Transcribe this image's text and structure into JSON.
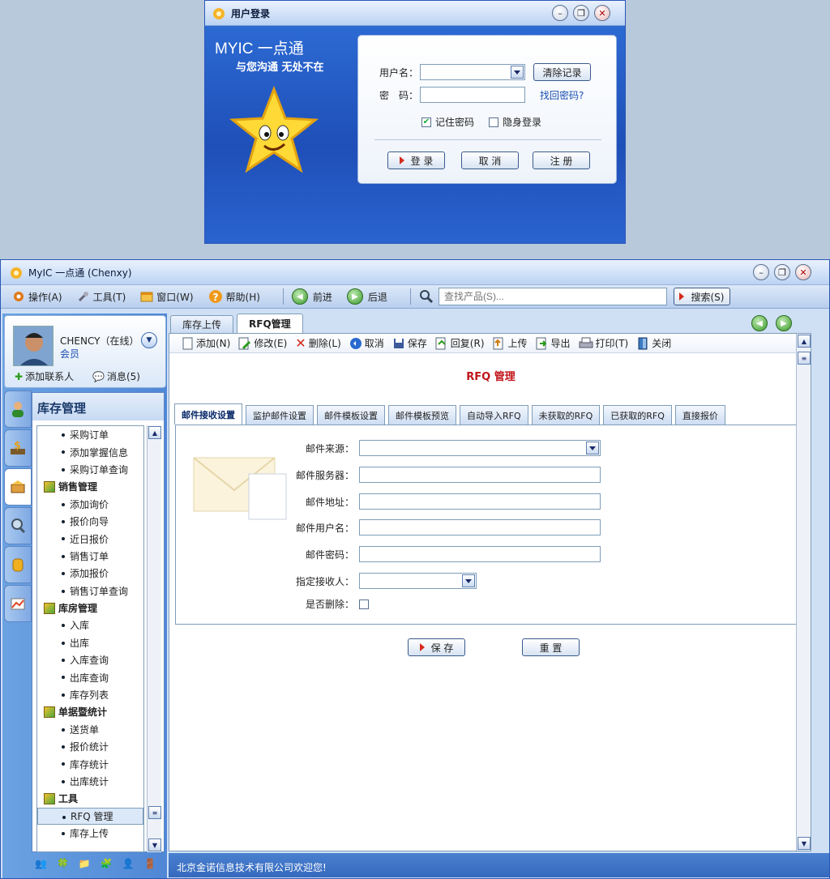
{
  "login": {
    "title": "用户登录",
    "brand": "MYIC 一点通",
    "slogan": "与您沟通 无处不在",
    "username_label": "用户名：",
    "password_label": "密　码：",
    "clear_button": "清除记录",
    "forgot_link": "找回密码?",
    "remember_label": "记住密码",
    "remember_checked": true,
    "invisible_label": "隐身登录",
    "invisible_checked": false,
    "login_button": "登 录",
    "cancel_button": "取 消",
    "register_button": "注 册"
  },
  "main": {
    "title": "MyIC 一点通  (Chenxy)",
    "menu": {
      "operate": "操作(A)",
      "tools": "工具(T)",
      "window": "窗口(W)",
      "help": "帮助(H)",
      "forward": "前进",
      "back": "后退",
      "search_placeholder": "查找产品(S)...",
      "search_button": "搜索(S)"
    },
    "user": {
      "name": "CHENCY（在线）",
      "role": "会员",
      "add_contact": "添加联系人",
      "messages": "消息(5)"
    },
    "nav": {
      "title": "库存管理",
      "items": [
        {
          "type": "sub",
          "label": "采购订单"
        },
        {
          "type": "sub",
          "label": "添加掌握信息"
        },
        {
          "type": "sub",
          "label": "采购订单查询"
        },
        {
          "type": "group",
          "label": "销售管理"
        },
        {
          "type": "sub",
          "label": "添加询价"
        },
        {
          "type": "sub",
          "label": "报价向导"
        },
        {
          "type": "sub",
          "label": "近日报价"
        },
        {
          "type": "sub",
          "label": "销售订单"
        },
        {
          "type": "sub",
          "label": "添加报价"
        },
        {
          "type": "sub",
          "label": "销售订单查询"
        },
        {
          "type": "group",
          "label": "库房管理"
        },
        {
          "type": "sub",
          "label": "入库"
        },
        {
          "type": "sub",
          "label": "出库"
        },
        {
          "type": "sub",
          "label": "入库查询"
        },
        {
          "type": "sub",
          "label": "出库查询"
        },
        {
          "type": "sub",
          "label": "库存列表"
        },
        {
          "type": "group",
          "label": "单据暨统计"
        },
        {
          "type": "sub",
          "label": "送货单"
        },
        {
          "type": "sub",
          "label": "报价统计"
        },
        {
          "type": "sub",
          "label": "库存统计"
        },
        {
          "type": "sub",
          "label": "出库统计"
        },
        {
          "type": "group",
          "label": "工具"
        },
        {
          "type": "sub",
          "label": "RFQ 管理",
          "selected": true
        },
        {
          "type": "sub",
          "label": "库存上传"
        }
      ]
    },
    "doc_tabs": [
      {
        "label": "库存上传",
        "active": false
      },
      {
        "label": "RFQ管理",
        "active": true
      }
    ],
    "toolbar": {
      "add": "添加(N)",
      "edit": "修改(E)",
      "delete": "删除(L)",
      "cancel": "取消",
      "save": "保存",
      "restore": "回复(R)",
      "upload": "上传",
      "export": "导出",
      "print": "打印(T)",
      "close": "关闭"
    },
    "page_title": "RFQ 管理",
    "sub_tabs": [
      {
        "label": "邮件接收设置",
        "active": true
      },
      {
        "label": "监护邮件设置",
        "active": false
      },
      {
        "label": "邮件模板设置",
        "active": false
      },
      {
        "label": "邮件模板预览",
        "active": false
      },
      {
        "label": "自动导入RFQ",
        "active": false
      },
      {
        "label": "未获取的RFQ",
        "active": false
      },
      {
        "label": "已获取的RFQ",
        "active": false
      },
      {
        "label": "直接报价",
        "active": false
      }
    ],
    "form": {
      "mail_source": "邮件来源：",
      "mail_server": "邮件服务器：",
      "mail_address": "邮件地址：",
      "mail_username": "邮件用户名：",
      "mail_password": "邮件密码：",
      "receiver": "指定接收人：",
      "delete_flag": "是否删除：",
      "save_button": "保 存",
      "reset_button": "重 置"
    },
    "status": "北京金诺信息技术有限公司欢迎您!"
  },
  "colors": {
    "accent": "#2f6fd8",
    "title_red": "#c0141a"
  }
}
